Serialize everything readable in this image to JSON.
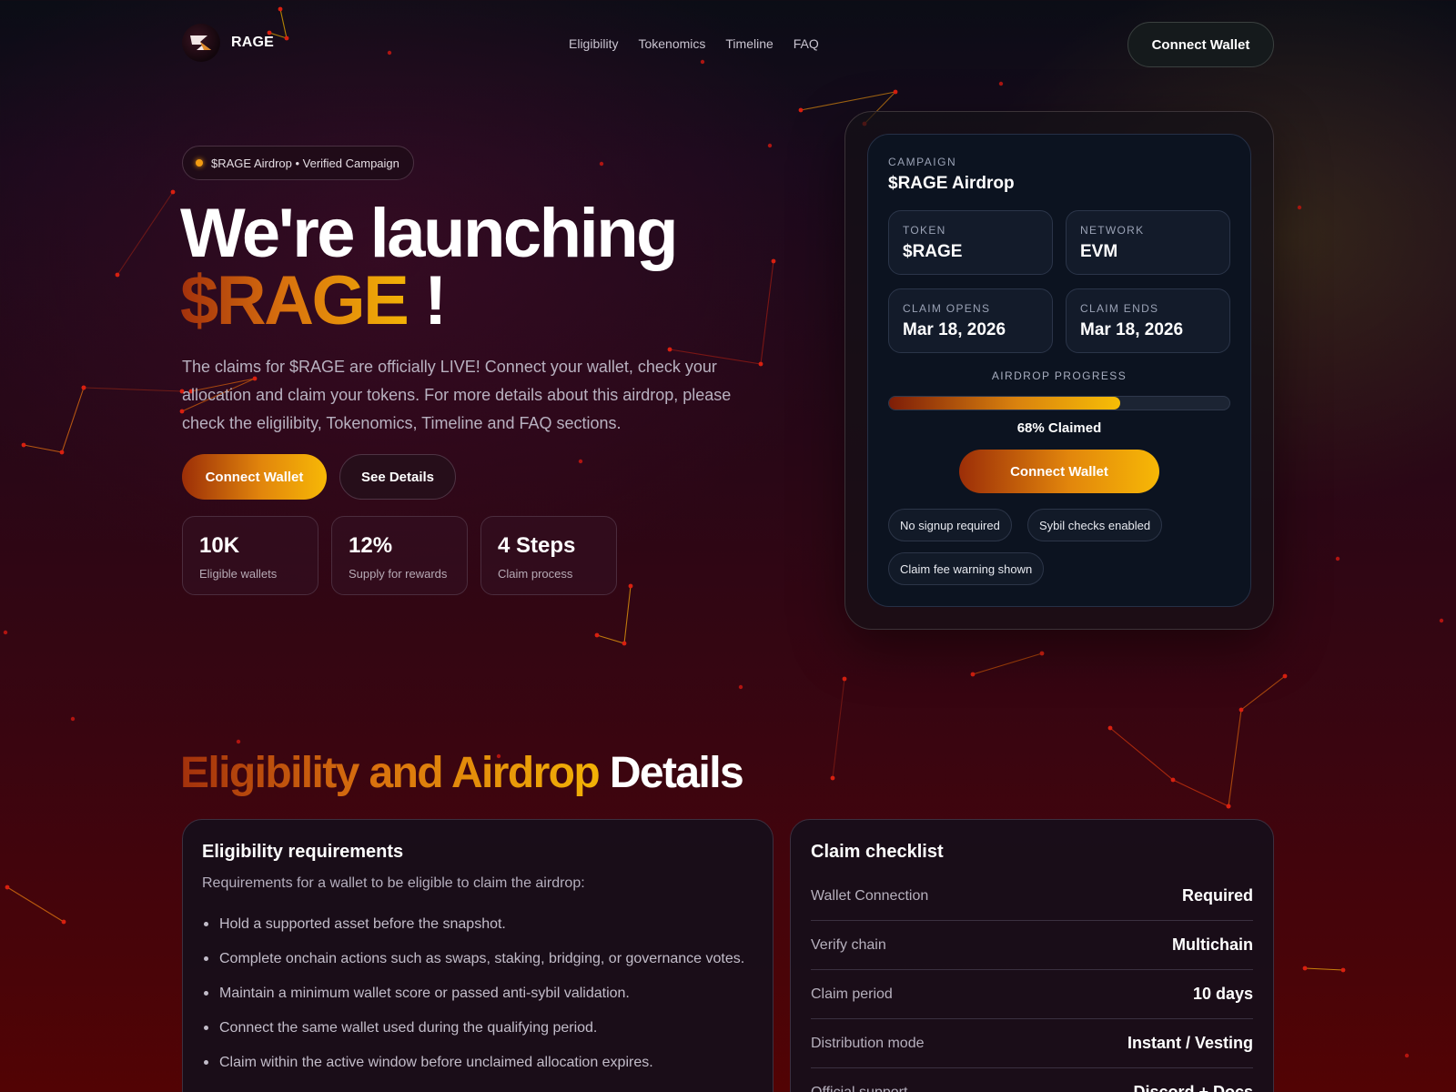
{
  "colors": {
    "accent_start": "#a3310c",
    "accent_mid": "#d8700e",
    "accent_end": "#f2b206",
    "background_top": "#0b0d16",
    "background_bottom": "#520304",
    "card_background": "#0c1320"
  },
  "header": {
    "logo_text": "RAGE",
    "logo_icon": "rage-logo-icon",
    "nav": [
      "Eligibility",
      "Tokenomics",
      "Timeline",
      "FAQ"
    ],
    "connect_label": "Connect Wallet"
  },
  "hero": {
    "badge": "$RAGE Airdrop • Verified Campaign",
    "title_line1": "We're launching",
    "title_token": "$RAGE",
    "title_bang": "!",
    "lead": "The claims for $RAGE are officially LIVE! Connect your wallet, check your allocation and claim your tokens. For more details about this airdrop, please check the eligilibity, Tokenomics, Timeline and FAQ sections.",
    "primary_button": "Connect Wallet",
    "secondary_button": "See Details",
    "stats": [
      {
        "value": "10K",
        "label": "Eligible wallets"
      },
      {
        "value": "12%",
        "label": "Supply for rewards"
      },
      {
        "value": "4 Steps",
        "label": "Claim process"
      }
    ]
  },
  "campaign": {
    "kicker": "CAMPAIGN",
    "title": "$RAGE Airdrop",
    "fields": [
      {
        "label": "TOKEN",
        "value": "$RAGE"
      },
      {
        "label": "NETWORK",
        "value": "EVM"
      },
      {
        "label": "CLAIM OPENS",
        "value": "Mar 18, 2026"
      },
      {
        "label": "CLAIM ENDS",
        "value": "Mar 18, 2026"
      }
    ],
    "progress_label": "AIRDROP PROGRESS",
    "progress_fraction": 0.68,
    "progress_text": "68% Claimed",
    "button": "Connect Wallet",
    "pills": [
      "No signup required",
      "Sybil checks enabled",
      "Claim fee warning shown"
    ]
  },
  "eligibility": {
    "title_gradient": "Eligibility and Airdrop",
    "title_plain": "Details",
    "requirements": {
      "title": "Eligibility requirements",
      "intro": "Requirements for a wallet to be eligible to claim the airdrop:",
      "items": [
        "Hold a supported asset before the snapshot.",
        "Complete onchain actions such as swaps, staking, bridging, or governance votes.",
        "Maintain a minimum wallet score or passed anti-sybil validation.",
        "Connect the same wallet used during the qualifying period.",
        "Claim within the active window before unclaimed allocation expires."
      ]
    },
    "checklist": {
      "title": "Claim checklist",
      "rows": [
        {
          "key": "Wallet Connection",
          "value": "Required"
        },
        {
          "key": "Verify chain",
          "value": "Multichain"
        },
        {
          "key": "Claim period",
          "value": "10 days"
        },
        {
          "key": "Distribution mode",
          "value": "Instant / Vesting"
        },
        {
          "key": "Official support",
          "value": "Discord + Docs"
        }
      ]
    }
  }
}
